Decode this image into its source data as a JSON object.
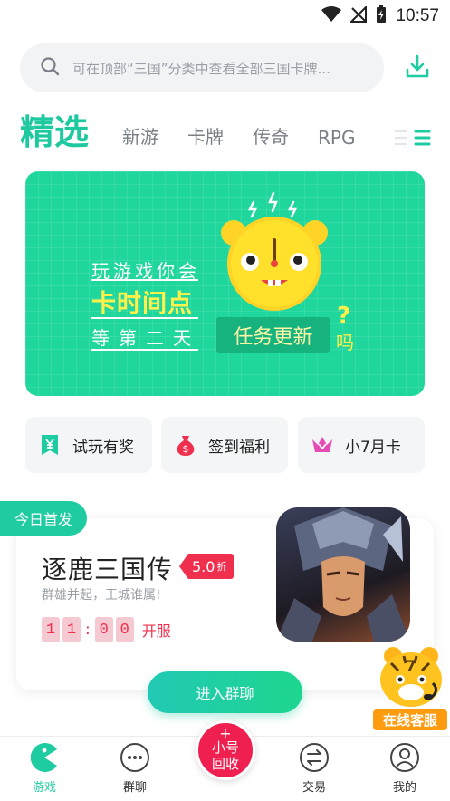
{
  "status_bar": {
    "time": "10:57",
    "icons": [
      "wifi-icon",
      "no-signal-icon",
      "battery-charging-icon"
    ]
  },
  "search": {
    "placeholder": "可在顶部“三国”分类中查看全部三国卡牌..."
  },
  "tabs": [
    {
      "label": "精选",
      "active": true
    },
    {
      "label": "新游"
    },
    {
      "label": "卡牌"
    },
    {
      "label": "传奇"
    },
    {
      "label": "RPG"
    }
  ],
  "banner": {
    "line1": "玩游戏你会",
    "line2": "卡时间点",
    "line3": "等第二天",
    "tag": "任务更新",
    "question": "?",
    "suffix": "吗"
  },
  "quick_actions": [
    {
      "label": "试玩有奖",
      "icon": "yuan-ticket-icon",
      "color": "#1fcca1"
    },
    {
      "label": "签到福利",
      "icon": "money-bag-icon",
      "color": "#ef2f4d"
    },
    {
      "label": "小7月卡",
      "icon": "crown-icon",
      "color": "#e64bb5"
    }
  ],
  "today": {
    "badge": "今日首发",
    "game_title": "逐鹿三国传",
    "discount_value": "5.0",
    "discount_unit": "折",
    "subtitle": "群雄并起，王城谁属!",
    "time_digits": [
      "1",
      "1",
      "0",
      "0"
    ],
    "time_sep": ":",
    "time_label": "开服",
    "join_button": "进入群聊"
  },
  "service": {
    "label": "在线客服"
  },
  "bottom_nav": {
    "items": [
      {
        "label": "游戏",
        "active": true
      },
      {
        "label": "群聊"
      },
      {
        "label": "交易"
      },
      {
        "label": "我的"
      }
    ],
    "center_plus": "+",
    "center_line1": "小号",
    "center_line2": "回收"
  },
  "colors": {
    "accent": "#1fcca1",
    "brand_red": "#ef1f4f",
    "banner_bg": "#1fd69c"
  }
}
